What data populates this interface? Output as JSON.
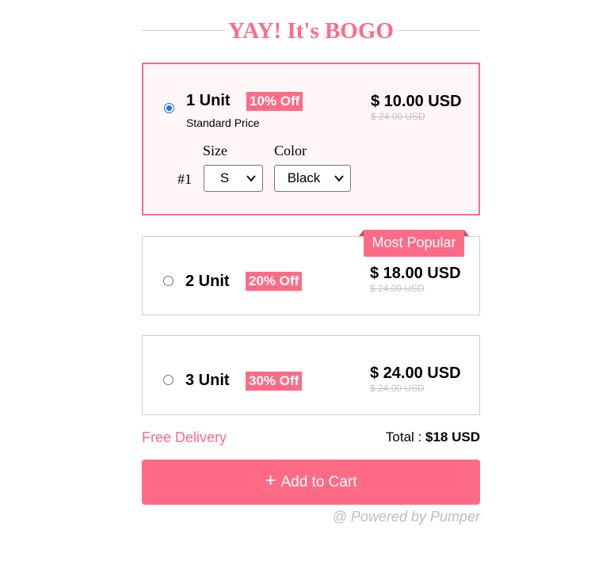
{
  "title": "YAY! It's BOGO",
  "options": [
    {
      "unit": "1 Unit",
      "discount": "10% Off",
      "price": "$ 10.00 USD",
      "old_price": "$ 24.00 USD",
      "subtitle": "Standard Price",
      "selected": true
    },
    {
      "unit": "2 Unit",
      "discount": "20% Off",
      "price": "$ 18.00 USD",
      "old_price": "$ 24.00 USD",
      "ribbon": "Most Popular",
      "selected": false
    },
    {
      "unit": "3 Unit",
      "discount": "30% Off",
      "price": "$ 24.00 USD",
      "old_price": "$ 24.00 USD",
      "selected": false
    }
  ],
  "variant": {
    "index_label": "#1",
    "size_label": "Size",
    "size_value": "S",
    "color_label": "Color",
    "color_value": "Black"
  },
  "footer": {
    "free_delivery": "Free Delivery",
    "total_label": "Total : ",
    "total_value": "$18 USD",
    "add_to_cart": "Add to Cart",
    "add_icon": "plus-icon",
    "powered_by": "@ Powered by Pumper"
  },
  "colors": {
    "accent": "#ff6b86",
    "selected_bg": "#fff6f7",
    "radio_checked": "#1a73e8",
    "muted": "#bdbdbd"
  }
}
